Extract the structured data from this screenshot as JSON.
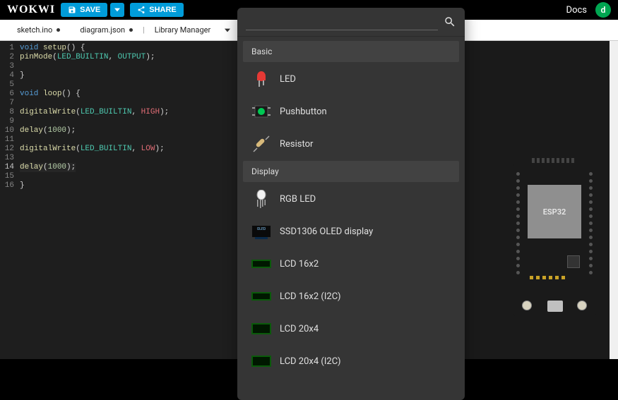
{
  "header": {
    "logo": "WOKWI",
    "save": "SAVE",
    "share": "SHARE",
    "docs": "Docs",
    "avatar_initial": "d"
  },
  "tabs": {
    "sketch": "sketch.ino",
    "diagram": "diagram.json",
    "library": "Library Manager"
  },
  "editor": {
    "lines": [
      {
        "n": "1",
        "tokens": [
          [
            "k-blue",
            "void "
          ],
          [
            "k-yel",
            "setup"
          ],
          [
            "k-pun",
            "() {"
          ]
        ]
      },
      {
        "n": "2",
        "tokens": [
          [
            "k-yel",
            "pinMode"
          ],
          [
            "k-pun",
            "("
          ],
          [
            "k-teal",
            "LED_BUILTIN"
          ],
          [
            "k-pun",
            ", "
          ],
          [
            "k-teal",
            "OUTPUT"
          ],
          [
            "k-pun",
            ");"
          ]
        ]
      },
      {
        "n": "3",
        "tokens": []
      },
      {
        "n": "4",
        "tokens": [
          [
            "k-pun",
            "}"
          ]
        ]
      },
      {
        "n": "5",
        "tokens": []
      },
      {
        "n": "6",
        "tokens": [
          [
            "k-blue",
            "void "
          ],
          [
            "k-yel",
            "loop"
          ],
          [
            "k-pun",
            "() {"
          ]
        ]
      },
      {
        "n": "7",
        "tokens": []
      },
      {
        "n": "8",
        "tokens": [
          [
            "k-yel",
            "digitalWrite"
          ],
          [
            "k-pun",
            "("
          ],
          [
            "k-teal",
            "LED_BUILTIN"
          ],
          [
            "k-pun",
            ", "
          ],
          [
            "k-red",
            "HIGH"
          ],
          [
            "k-pun",
            ");"
          ]
        ]
      },
      {
        "n": "9",
        "tokens": []
      },
      {
        "n": "10",
        "tokens": [
          [
            "k-yel",
            "delay"
          ],
          [
            "k-pun",
            "("
          ],
          [
            "k-num",
            "1000"
          ],
          [
            "k-pun",
            ");"
          ]
        ]
      },
      {
        "n": "11",
        "tokens": []
      },
      {
        "n": "12",
        "tokens": [
          [
            "k-yel",
            "digitalWrite"
          ],
          [
            "k-pun",
            "("
          ],
          [
            "k-teal",
            "LED_BUILTIN"
          ],
          [
            "k-pun",
            ", "
          ],
          [
            "k-red",
            "LOW"
          ],
          [
            "k-pun",
            ");"
          ]
        ]
      },
      {
        "n": "13",
        "tokens": []
      },
      {
        "n": "14",
        "tokens": [
          [
            "k-yel",
            "delay"
          ],
          [
            "k-pun",
            "("
          ],
          [
            "k-num",
            "1000"
          ],
          [
            "k-pun",
            ");"
          ]
        ],
        "current": true
      },
      {
        "n": "15",
        "tokens": []
      },
      {
        "n": "16",
        "tokens": [
          [
            "k-pun",
            "}"
          ]
        ]
      }
    ]
  },
  "picker": {
    "search_placeholder": "",
    "cat_basic": "Basic",
    "cat_display": "Display",
    "parts": {
      "led": "LED",
      "pushbutton": "Pushbutton",
      "resistor": "Resistor",
      "rgbled": "RGB LED",
      "oled": "SSD1306 OLED display",
      "lcd16x2": "LCD 16x2",
      "lcd16x2i2c": "LCD 16x2 (I2C)",
      "lcd20x4": "LCD 20x4",
      "lcd20x4i2c": "LCD 20x4 (I2C)"
    }
  },
  "board": {
    "chip_label": "ESP32"
  }
}
